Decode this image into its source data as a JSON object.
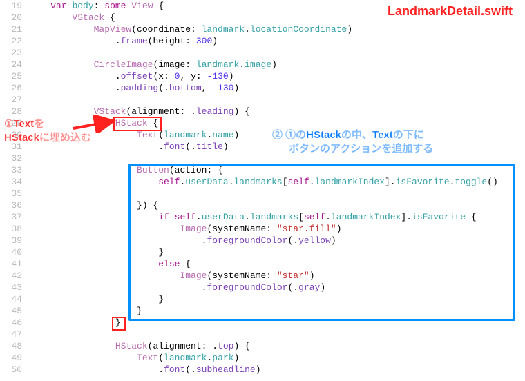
{
  "file_label": "LandmarkDetail.swift",
  "annotations": {
    "ann1_line1": "①Textを",
    "ann1_line2": "HStackに埋め込む",
    "ann2_line1": "② ①のHStackの中、Textの下に",
    "ann2_line2": "ボタンのアクションを追加する"
  },
  "lines": [
    {
      "n": 19,
      "tokens": [
        {
          "t": "    "
        },
        {
          "t": "var",
          "c": "kw"
        },
        {
          "t": " "
        },
        {
          "t": "body",
          "c": "ident"
        },
        {
          "t": ": "
        },
        {
          "t": "some",
          "c": "kw"
        },
        {
          "t": " "
        },
        {
          "t": "View",
          "c": "typ"
        },
        {
          "t": " {"
        }
      ]
    },
    {
      "n": 20,
      "tokens": [
        {
          "t": "        "
        },
        {
          "t": "VStack",
          "c": "typ"
        },
        {
          "t": " {"
        }
      ]
    },
    {
      "n": 21,
      "tokens": [
        {
          "t": "            "
        },
        {
          "t": "MapView",
          "c": "typ"
        },
        {
          "t": "(coordinate: "
        },
        {
          "t": "landmark",
          "c": "ident"
        },
        {
          "t": "."
        },
        {
          "t": "locationCoordinate",
          "c": "attr"
        },
        {
          "t": ")"
        }
      ]
    },
    {
      "n": 22,
      "tokens": [
        {
          "t": "                ."
        },
        {
          "t": "frame",
          "c": "fn2"
        },
        {
          "t": "(height: "
        },
        {
          "t": "300",
          "c": "num"
        },
        {
          "t": ")"
        }
      ]
    },
    {
      "n": 23,
      "tokens": []
    },
    {
      "n": 24,
      "tokens": [
        {
          "t": "            "
        },
        {
          "t": "CircleImage",
          "c": "typ"
        },
        {
          "t": "(image: "
        },
        {
          "t": "landmark",
          "c": "ident"
        },
        {
          "t": "."
        },
        {
          "t": "image",
          "c": "attr"
        },
        {
          "t": ")"
        }
      ]
    },
    {
      "n": 25,
      "tokens": [
        {
          "t": "                ."
        },
        {
          "t": "offset",
          "c": "fn2"
        },
        {
          "t": "(x: "
        },
        {
          "t": "0",
          "c": "num"
        },
        {
          "t": ", y: "
        },
        {
          "t": "-130",
          "c": "num"
        },
        {
          "t": ")"
        }
      ]
    },
    {
      "n": 26,
      "tokens": [
        {
          "t": "                ."
        },
        {
          "t": "padding",
          "c": "fn2"
        },
        {
          "t": "(."
        },
        {
          "t": "bottom",
          "c": "fn2"
        },
        {
          "t": ", "
        },
        {
          "t": "-130",
          "c": "num"
        },
        {
          "t": ")"
        }
      ]
    },
    {
      "n": 27,
      "tokens": []
    },
    {
      "n": 28,
      "tokens": [
        {
          "t": "            "
        },
        {
          "t": "VStack",
          "c": "typ"
        },
        {
          "t": "(alignment: ."
        },
        {
          "t": "leading",
          "c": "fn2"
        },
        {
          "t": ") {"
        }
      ]
    },
    {
      "n": 29,
      "tokens": [
        {
          "t": "                "
        },
        {
          "t": "HStack",
          "c": "typ"
        },
        {
          "t": " {"
        }
      ]
    },
    {
      "n": 30,
      "tokens": [
        {
          "t": "                    "
        },
        {
          "t": "Text",
          "c": "typ"
        },
        {
          "t": "("
        },
        {
          "t": "landmark",
          "c": "ident"
        },
        {
          "t": "."
        },
        {
          "t": "name",
          "c": "attr"
        },
        {
          "t": ")"
        }
      ]
    },
    {
      "n": 31,
      "tokens": [
        {
          "t": "                        ."
        },
        {
          "t": "font",
          "c": "fn2"
        },
        {
          "t": "(."
        },
        {
          "t": "title",
          "c": "fn2"
        },
        {
          "t": ")"
        }
      ]
    },
    {
      "n": 32,
      "tokens": []
    },
    {
      "n": 33,
      "tokens": [
        {
          "t": "                    "
        },
        {
          "t": "Button",
          "c": "typ"
        },
        {
          "t": "(action: {"
        }
      ]
    },
    {
      "n": 34,
      "tokens": [
        {
          "t": "                        "
        },
        {
          "t": "self",
          "c": "kw"
        },
        {
          "t": "."
        },
        {
          "t": "userData",
          "c": "ident"
        },
        {
          "t": "."
        },
        {
          "t": "landmarks",
          "c": "attr"
        },
        {
          "t": "["
        },
        {
          "t": "self",
          "c": "kw"
        },
        {
          "t": "."
        },
        {
          "t": "landmarkIndex",
          "c": "ident"
        },
        {
          "t": "]."
        },
        {
          "t": "isFavorite",
          "c": "attr"
        },
        {
          "t": "."
        },
        {
          "t": "toggle",
          "c": "fn"
        },
        {
          "t": "()"
        }
      ]
    },
    {
      "n": 35,
      "tokens": []
    },
    {
      "n": 36,
      "tokens": [
        {
          "t": "                    }) {"
        }
      ]
    },
    {
      "n": 37,
      "tokens": [
        {
          "t": "                        "
        },
        {
          "t": "if",
          "c": "kw"
        },
        {
          "t": " "
        },
        {
          "t": "self",
          "c": "kw"
        },
        {
          "t": "."
        },
        {
          "t": "userData",
          "c": "ident"
        },
        {
          "t": "."
        },
        {
          "t": "landmarks",
          "c": "attr"
        },
        {
          "t": "["
        },
        {
          "t": "self",
          "c": "kw"
        },
        {
          "t": "."
        },
        {
          "t": "landmarkIndex",
          "c": "ident"
        },
        {
          "t": "]."
        },
        {
          "t": "isFavorite",
          "c": "attr"
        },
        {
          "t": " {"
        }
      ]
    },
    {
      "n": 38,
      "tokens": [
        {
          "t": "                            "
        },
        {
          "t": "Image",
          "c": "typ"
        },
        {
          "t": "(systemName: "
        },
        {
          "t": "\"star.fill\"",
          "c": "str"
        },
        {
          "t": ")"
        }
      ]
    },
    {
      "n": 39,
      "tokens": [
        {
          "t": "                                ."
        },
        {
          "t": "foregroundColor",
          "c": "fn2"
        },
        {
          "t": "(."
        },
        {
          "t": "yellow",
          "c": "fn2"
        },
        {
          "t": ")"
        }
      ]
    },
    {
      "n": 40,
      "tokens": [
        {
          "t": "                        }"
        }
      ]
    },
    {
      "n": 41,
      "tokens": [
        {
          "t": "                        "
        },
        {
          "t": "else",
          "c": "kw"
        },
        {
          "t": " {"
        }
      ]
    },
    {
      "n": 42,
      "tokens": [
        {
          "t": "                            "
        },
        {
          "t": "Image",
          "c": "typ"
        },
        {
          "t": "(systemName: "
        },
        {
          "t": "\"star\"",
          "c": "str"
        },
        {
          "t": ")"
        }
      ]
    },
    {
      "n": 43,
      "tokens": [
        {
          "t": "                                ."
        },
        {
          "t": "foregroundColor",
          "c": "fn2"
        },
        {
          "t": "(."
        },
        {
          "t": "gray",
          "c": "fn2"
        },
        {
          "t": ")"
        }
      ]
    },
    {
      "n": 44,
      "tokens": [
        {
          "t": "                        }"
        }
      ]
    },
    {
      "n": 45,
      "tokens": [
        {
          "t": "                    }"
        }
      ]
    },
    {
      "n": 46,
      "tokens": [
        {
          "t": "                }"
        }
      ]
    },
    {
      "n": 47,
      "tokens": []
    },
    {
      "n": 48,
      "tokens": [
        {
          "t": "                "
        },
        {
          "t": "HStack",
          "c": "typ"
        },
        {
          "t": "(alignment: ."
        },
        {
          "t": "top",
          "c": "fn2"
        },
        {
          "t": ") {"
        }
      ]
    },
    {
      "n": 49,
      "tokens": [
        {
          "t": "                    "
        },
        {
          "t": "Text",
          "c": "typ"
        },
        {
          "t": "("
        },
        {
          "t": "landmark",
          "c": "ident"
        },
        {
          "t": "."
        },
        {
          "t": "park",
          "c": "attr"
        },
        {
          "t": ")"
        }
      ]
    },
    {
      "n": 50,
      "tokens": [
        {
          "t": "                        ."
        },
        {
          "t": "font",
          "c": "fn2"
        },
        {
          "t": "(."
        },
        {
          "t": "subheadline",
          "c": "fn2"
        },
        {
          "t": ")"
        }
      ]
    }
  ]
}
